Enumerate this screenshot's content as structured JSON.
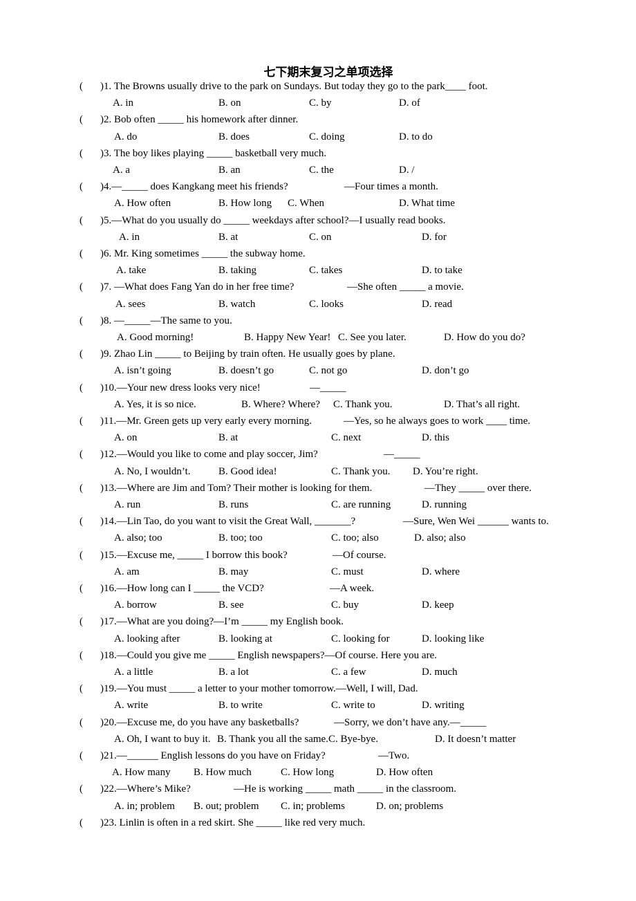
{
  "title": "七下期末复习之单项选择",
  "paren_open": "(",
  "questions": [
    {
      "num": ")1.",
      "parts": [
        " The Browns usually drive to the park on Sundays. But today they go to the park____ foot."
      ],
      "options": [
        "A. in",
        "B. on",
        "C. by",
        "D. of"
      ]
    },
    {
      "num": ")2.",
      "parts": [
        " Bob often _____ his homework after dinner."
      ],
      "options": [
        "A. do",
        "B. does",
        "C. doing",
        "D. to do"
      ]
    },
    {
      "num": ")3.",
      "parts": [
        " The boy likes playing _____ basketball very much."
      ],
      "options": [
        "A. a",
        "B. an",
        "C. the",
        "D. /"
      ]
    },
    {
      "num": ")4.",
      "parts": [
        "—_____ does Kangkang meet his friends?",
        "—Four times a month."
      ],
      "options": [
        "A. How often",
        "B. How long",
        "C. When",
        "D. What time"
      ]
    },
    {
      "num": ")5.",
      "parts": [
        "—What do you usually do _____ weekdays after school?—I usually read books."
      ],
      "options": [
        "A. in",
        "B. at",
        "C. on",
        "D. for"
      ]
    },
    {
      "num": ")6.",
      "parts": [
        " Mr. King sometimes _____ the subway home."
      ],
      "options": [
        "A. take",
        "B. taking",
        "C. takes",
        "D. to take"
      ]
    },
    {
      "num": ")7.",
      "parts": [
        " —What does Fang Yan do in her free time?",
        "—She often _____ a movie."
      ],
      "options": [
        "A. sees",
        "B. watch",
        "C. looks",
        "D. read"
      ]
    },
    {
      "num": ")8.",
      "parts": [
        " —_____—The same to you."
      ],
      "options": [
        "A. Good morning!",
        "B. Happy New Year!",
        "C. See you later.",
        "D. How do you do?"
      ]
    },
    {
      "num": ")9.",
      "parts": [
        " Zhao Lin _____ to Beijing by train often. He usually goes by plane."
      ],
      "options": [
        "A. isn’t going",
        "B. doesn’t go",
        "C. not go",
        "D. don’t go"
      ]
    },
    {
      "num": ")10.",
      "parts": [
        "—Your new dress looks very nice!",
        "—_____"
      ],
      "options": [
        "A. Yes, it is so nice.",
        "B. Where? Where?",
        "C. Thank you.",
        "D. That’s all right."
      ]
    },
    {
      "num": ")11.",
      "parts": [
        "—Mr. Green gets up very early every morning.",
        "—Yes, so he always goes to work ____ time."
      ],
      "options": [
        "A. on",
        "B. at",
        "C. next",
        "D. this"
      ]
    },
    {
      "num": ")12.",
      "parts": [
        "—Would you like to come and play soccer, Jim?",
        "—_____"
      ],
      "options": [
        "A. No, I wouldn’t.",
        "B. Good idea!",
        "C. Thank you.",
        "D. You’re right."
      ]
    },
    {
      "num": ")13.",
      "parts": [
        "—Where are Jim and Tom? Their mother is looking for them.",
        "—They _____ over there."
      ],
      "options": [
        "A. run",
        "B. runs",
        "C. are running",
        "D. running"
      ]
    },
    {
      "num": ")14.",
      "parts": [
        "—Lin Tao, do you want to visit the Great Wall, _______?",
        "—Sure, Wen Wei ______ wants to."
      ],
      "options": [
        "A. also; too",
        "B. too; too",
        "C. too; also",
        "D. also; also"
      ]
    },
    {
      "num": ")15.",
      "parts": [
        "—Excuse me, _____ I borrow this book?",
        "—Of course."
      ],
      "options": [
        "A. am",
        "B. may",
        "C. must",
        "D. where"
      ]
    },
    {
      "num": ")16.",
      "parts": [
        "—How long can I _____ the VCD?",
        "—A week."
      ],
      "options": [
        "A. borrow",
        "B. see",
        "C. buy",
        "D. keep"
      ]
    },
    {
      "num": ")17.",
      "parts": [
        "—What are you doing?—I’m _____ my English book."
      ],
      "options": [
        "A. looking after",
        "B. looking at",
        "C. looking for",
        "D. looking like"
      ]
    },
    {
      "num": ")18.",
      "parts": [
        "—Could you give me _____ English newspapers?—Of course. Here you are."
      ],
      "options": [
        "A. a little",
        "B. a lot",
        "C. a few",
        "D. much"
      ]
    },
    {
      "num": ")19.",
      "parts": [
        "—You must _____ a letter to your mother tomorrow.—Well, I will, Dad."
      ],
      "options": [
        "A. write",
        "B. to write",
        "C. write to",
        "D. writing"
      ]
    },
    {
      "num": ")20.",
      "parts": [
        "—Excuse me, do you have any basketballs?",
        "—Sorry, we don’t have any.—_____"
      ],
      "options": [
        "A. Oh, I want to buy it.",
        "B. Thank you all the same.",
        "C. Bye-bye.",
        "D. It doesn’t matter"
      ]
    },
    {
      "num": ")21.",
      "parts": [
        "—______ English lessons do you have on Friday?",
        "—Two."
      ],
      "options": [
        "A. How many",
        "B. How much",
        "C. How long",
        "D. How often"
      ]
    },
    {
      "num": ")22.",
      "parts": [
        "—Where’s Mike?",
        "—He is working _____ math _____ in the classroom."
      ],
      "options": [
        "A. in; problem",
        "B. out; problem",
        "C. in; problems",
        "D. on; problems"
      ]
    },
    {
      "num": ")23.",
      "parts": [
        " Linlin is often in a red skirt. She _____ like red very much."
      ],
      "options": []
    }
  ]
}
